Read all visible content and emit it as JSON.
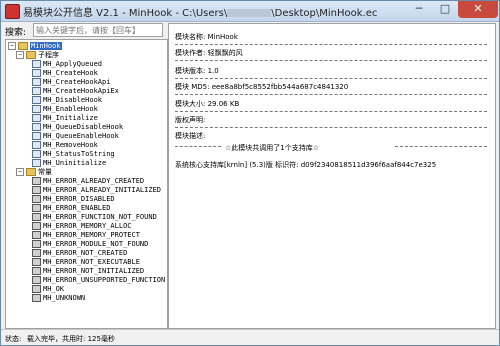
{
  "window": {
    "title_left": "易模块公开信息 V2.1 - MinHook - C:\\Users\\",
    "title_right": "\\Desktop\\MinHook.ec",
    "min": "─",
    "max": "□",
    "close": "✕"
  },
  "search": {
    "label": "搜索:",
    "placeholder": "输入关键字后，请按【回车】"
  },
  "tree": {
    "root": "MinHook",
    "groups": [
      {
        "label": "子程序",
        "items": [
          "MH_ApplyQueued",
          "MH_CreateHook",
          "MH_CreateHookApi",
          "MH_CreateHookApiEx",
          "MH_DisableHook",
          "MH_EnableHook",
          "MH_Initialize",
          "MH_QueueDisableHook",
          "MH_QueueEnableHook",
          "MH_RemoveHook",
          "MH_StatusToString",
          "MH_Uninitialize"
        ]
      },
      {
        "label": "常量",
        "items": [
          "MH_ERROR_ALREADY_CREATED",
          "MH_ERROR_ALREADY_INITIALIZED",
          "MH_ERROR_DISABLED",
          "MH_ERROR_ENABLED",
          "MH_ERROR_FUNCTION_NOT_FOUND",
          "MH_ERROR_MEMORY_ALLOC",
          "MH_ERROR_MEMORY_PROTECT",
          "MH_ERROR_MODULE_NOT_FOUND",
          "MH_ERROR_NOT_CREATED",
          "MH_ERROR_NOT_EXECUTABLE",
          "MH_ERROR_NOT_INITIALIZED",
          "MH_ERROR_UNSUPPORTED_FUNCTION",
          "MH_OK",
          "MH_UNKNOWN"
        ]
      }
    ]
  },
  "info": {
    "name": "模块名称: MinHook",
    "author": "模块作者: 轻飘飘的风",
    "version": "模块版本: 1.0",
    "md5": "模块 MD5: eee8a8bf5c8552fbb544a687c4841320",
    "size": "模块大小: 29.06 KB",
    "copyright": "版权声明:",
    "description": "模块描述:",
    "support_note": "☆此模块共调用了1个支持库☆",
    "support_lib": "系统核心支持库[krnln] (5.3)版 标识符: d09f2340818511d396f6aaf844c7e325"
  },
  "status": {
    "label": "状态:",
    "text": "载入完毕，共用时: 125毫秒"
  }
}
